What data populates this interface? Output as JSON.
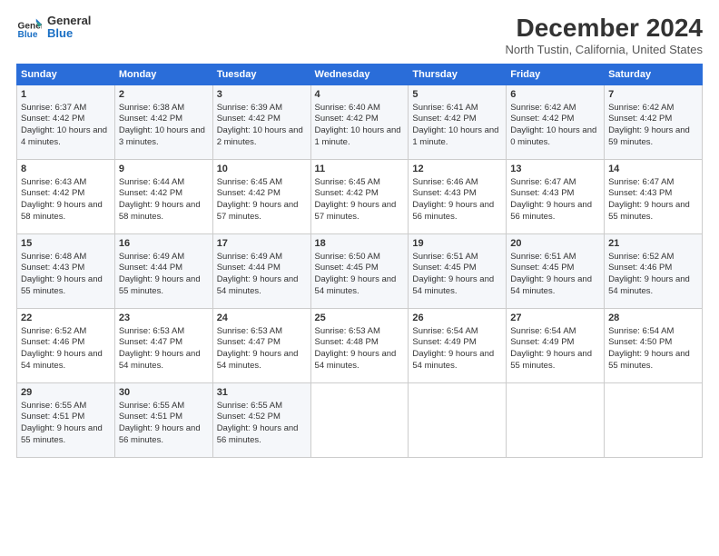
{
  "logo": {
    "line1": "General",
    "line2": "Blue"
  },
  "title": "December 2024",
  "subtitle": "North Tustin, California, United States",
  "days_of_week": [
    "Sunday",
    "Monday",
    "Tuesday",
    "Wednesday",
    "Thursday",
    "Friday",
    "Saturday"
  ],
  "weeks": [
    [
      {
        "day": "1",
        "sunrise": "Sunrise: 6:37 AM",
        "sunset": "Sunset: 4:42 PM",
        "daylight": "Daylight: 10 hours and 4 minutes."
      },
      {
        "day": "2",
        "sunrise": "Sunrise: 6:38 AM",
        "sunset": "Sunset: 4:42 PM",
        "daylight": "Daylight: 10 hours and 3 minutes."
      },
      {
        "day": "3",
        "sunrise": "Sunrise: 6:39 AM",
        "sunset": "Sunset: 4:42 PM",
        "daylight": "Daylight: 10 hours and 2 minutes."
      },
      {
        "day": "4",
        "sunrise": "Sunrise: 6:40 AM",
        "sunset": "Sunset: 4:42 PM",
        "daylight": "Daylight: 10 hours and 1 minute."
      },
      {
        "day": "5",
        "sunrise": "Sunrise: 6:41 AM",
        "sunset": "Sunset: 4:42 PM",
        "daylight": "Daylight: 10 hours and 1 minute."
      },
      {
        "day": "6",
        "sunrise": "Sunrise: 6:42 AM",
        "sunset": "Sunset: 4:42 PM",
        "daylight": "Daylight: 10 hours and 0 minutes."
      },
      {
        "day": "7",
        "sunrise": "Sunrise: 6:42 AM",
        "sunset": "Sunset: 4:42 PM",
        "daylight": "Daylight: 9 hours and 59 minutes."
      }
    ],
    [
      {
        "day": "8",
        "sunrise": "Sunrise: 6:43 AM",
        "sunset": "Sunset: 4:42 PM",
        "daylight": "Daylight: 9 hours and 58 minutes."
      },
      {
        "day": "9",
        "sunrise": "Sunrise: 6:44 AM",
        "sunset": "Sunset: 4:42 PM",
        "daylight": "Daylight: 9 hours and 58 minutes."
      },
      {
        "day": "10",
        "sunrise": "Sunrise: 6:45 AM",
        "sunset": "Sunset: 4:42 PM",
        "daylight": "Daylight: 9 hours and 57 minutes."
      },
      {
        "day": "11",
        "sunrise": "Sunrise: 6:45 AM",
        "sunset": "Sunset: 4:42 PM",
        "daylight": "Daylight: 9 hours and 57 minutes."
      },
      {
        "day": "12",
        "sunrise": "Sunrise: 6:46 AM",
        "sunset": "Sunset: 4:43 PM",
        "daylight": "Daylight: 9 hours and 56 minutes."
      },
      {
        "day": "13",
        "sunrise": "Sunrise: 6:47 AM",
        "sunset": "Sunset: 4:43 PM",
        "daylight": "Daylight: 9 hours and 56 minutes."
      },
      {
        "day": "14",
        "sunrise": "Sunrise: 6:47 AM",
        "sunset": "Sunset: 4:43 PM",
        "daylight": "Daylight: 9 hours and 55 minutes."
      }
    ],
    [
      {
        "day": "15",
        "sunrise": "Sunrise: 6:48 AM",
        "sunset": "Sunset: 4:43 PM",
        "daylight": "Daylight: 9 hours and 55 minutes."
      },
      {
        "day": "16",
        "sunrise": "Sunrise: 6:49 AM",
        "sunset": "Sunset: 4:44 PM",
        "daylight": "Daylight: 9 hours and 55 minutes."
      },
      {
        "day": "17",
        "sunrise": "Sunrise: 6:49 AM",
        "sunset": "Sunset: 4:44 PM",
        "daylight": "Daylight: 9 hours and 54 minutes."
      },
      {
        "day": "18",
        "sunrise": "Sunrise: 6:50 AM",
        "sunset": "Sunset: 4:45 PM",
        "daylight": "Daylight: 9 hours and 54 minutes."
      },
      {
        "day": "19",
        "sunrise": "Sunrise: 6:51 AM",
        "sunset": "Sunset: 4:45 PM",
        "daylight": "Daylight: 9 hours and 54 minutes."
      },
      {
        "day": "20",
        "sunrise": "Sunrise: 6:51 AM",
        "sunset": "Sunset: 4:45 PM",
        "daylight": "Daylight: 9 hours and 54 minutes."
      },
      {
        "day": "21",
        "sunrise": "Sunrise: 6:52 AM",
        "sunset": "Sunset: 4:46 PM",
        "daylight": "Daylight: 9 hours and 54 minutes."
      }
    ],
    [
      {
        "day": "22",
        "sunrise": "Sunrise: 6:52 AM",
        "sunset": "Sunset: 4:46 PM",
        "daylight": "Daylight: 9 hours and 54 minutes."
      },
      {
        "day": "23",
        "sunrise": "Sunrise: 6:53 AM",
        "sunset": "Sunset: 4:47 PM",
        "daylight": "Daylight: 9 hours and 54 minutes."
      },
      {
        "day": "24",
        "sunrise": "Sunrise: 6:53 AM",
        "sunset": "Sunset: 4:47 PM",
        "daylight": "Daylight: 9 hours and 54 minutes."
      },
      {
        "day": "25",
        "sunrise": "Sunrise: 6:53 AM",
        "sunset": "Sunset: 4:48 PM",
        "daylight": "Daylight: 9 hours and 54 minutes."
      },
      {
        "day": "26",
        "sunrise": "Sunrise: 6:54 AM",
        "sunset": "Sunset: 4:49 PM",
        "daylight": "Daylight: 9 hours and 54 minutes."
      },
      {
        "day": "27",
        "sunrise": "Sunrise: 6:54 AM",
        "sunset": "Sunset: 4:49 PM",
        "daylight": "Daylight: 9 hours and 55 minutes."
      },
      {
        "day": "28",
        "sunrise": "Sunrise: 6:54 AM",
        "sunset": "Sunset: 4:50 PM",
        "daylight": "Daylight: 9 hours and 55 minutes."
      }
    ],
    [
      {
        "day": "29",
        "sunrise": "Sunrise: 6:55 AM",
        "sunset": "Sunset: 4:51 PM",
        "daylight": "Daylight: 9 hours and 55 minutes."
      },
      {
        "day": "30",
        "sunrise": "Sunrise: 6:55 AM",
        "sunset": "Sunset: 4:51 PM",
        "daylight": "Daylight: 9 hours and 56 minutes."
      },
      {
        "day": "31",
        "sunrise": "Sunrise: 6:55 AM",
        "sunset": "Sunset: 4:52 PM",
        "daylight": "Daylight: 9 hours and 56 minutes."
      },
      null,
      null,
      null,
      null
    ]
  ]
}
